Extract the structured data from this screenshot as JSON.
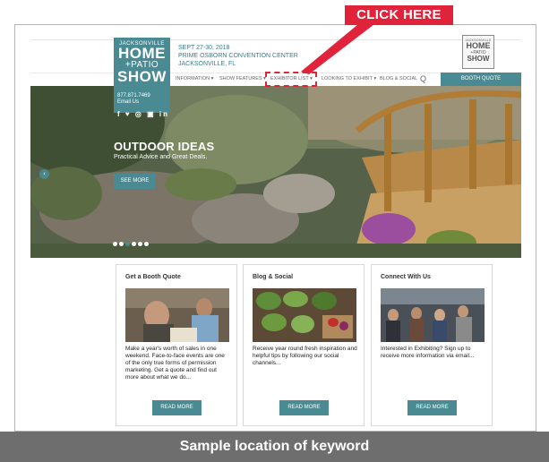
{
  "callout": {
    "label": "CLICK HERE"
  },
  "logo": {
    "small": "JACKSONVILLE",
    "home": "HOME",
    "patio": "+PATIO",
    "show": "SHOW"
  },
  "logo_right": {
    "small": "JACKSONVILLE",
    "home": "HOME",
    "patio": "+PATIO",
    "show": "SHOW"
  },
  "event": {
    "dates": "SEPT 27-30, 2018",
    "venue": "PRIME OSBORN CONVENTION CENTER",
    "city": "JACKSONVILLE, FL"
  },
  "nav": {
    "items": [
      {
        "label": "INFORMATION ▾"
      },
      {
        "label": "SHOW FEATURES ▾"
      },
      {
        "label": "EXHIBITOR LIST ▾"
      },
      {
        "label": "LOOKING TO EXHIBIT ▾"
      },
      {
        "label": "BLOG & SOCIAL"
      }
    ],
    "search_icon": "Q",
    "booth_quote": "BOOTH QUOTE"
  },
  "contact": {
    "phone": "877.871.7469",
    "email": "Email Us",
    "social": "f ♥ ◎ ▣ in"
  },
  "hero": {
    "title": "OUTDOOR IDEAS",
    "subtitle": "Practical Advice and Great Deals.",
    "button": "SEE MORE",
    "prev": "‹",
    "slide_count": 6,
    "active_slide": 3
  },
  "cards": [
    {
      "title": "Get a Booth Quote",
      "text": "Make a year's worth of sales in one weekend. Face-to-face events are one of the only true forms of permission marketing. Get a quote and find out more about what we do...",
      "button": "READ MORE"
    },
    {
      "title": "Blog & Social",
      "text": "Receive year round fresh inspiration and helpful tips by following our social channels...",
      "button": "READ MORE"
    },
    {
      "title": "Connect With Us",
      "text": "Interested in Exhibiting? Sign up to receive more information via email...",
      "button": "READ MORE"
    }
  ],
  "banner": {
    "label": "Sample location of keyword"
  },
  "colors": {
    "accent": "#4a8a92",
    "callout": "#e0233a",
    "banner": "#6e6e6e"
  }
}
